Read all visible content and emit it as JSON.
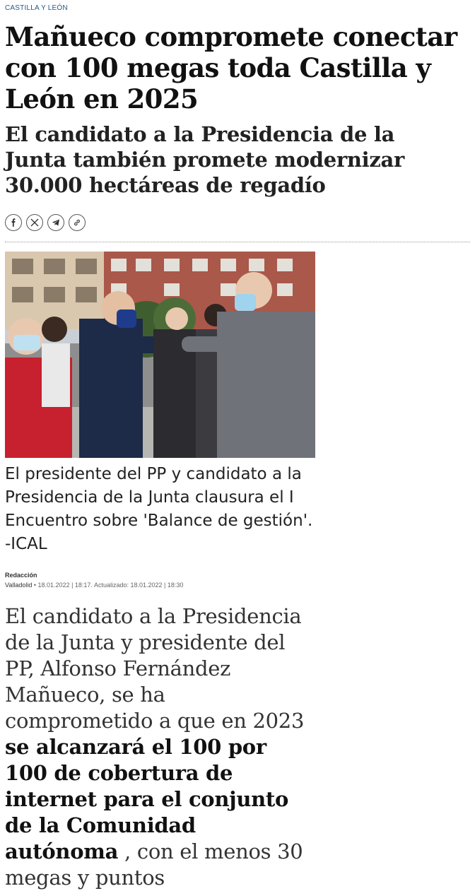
{
  "section": "CASTILLA Y LEÓN",
  "headline": "Mañueco compromete conectar con 100 megas toda Castilla y León en 2025",
  "subtitle": "El candidato a la Presidencia de la Junta también promete modernizar 30.000 hectáreas de regadío",
  "share": {
    "icons": [
      "facebook-icon",
      "x-icon",
      "telegram-icon",
      "link-icon"
    ]
  },
  "photo": {
    "caption": "El presidente del PP y candidato a la Presidencia de la Junta clausura el I Encuentro sobre 'Balance de gestión'. -ICAL"
  },
  "byline": {
    "author": "Redacción",
    "location": "Valladolid",
    "separator": " • ",
    "published": "18.01.2022 | 18:17. Actualizado: 18.01.2022 | 18:30"
  },
  "body": {
    "lead": "El candidato a la Presidencia de la Junta y presidente del PP, Alfonso Fernández Mañueco, se ha comprometido a que en 2023 ",
    "bold": "se alcanzará el 100 por 100 de cobertura de internet para el conjunto de la Comunidad autónoma",
    "tail": " , con el menos 30 megas y puntos"
  },
  "colors": {
    "section_tag": "#1f5a8c",
    "text": "#111111",
    "border": "#555555"
  }
}
